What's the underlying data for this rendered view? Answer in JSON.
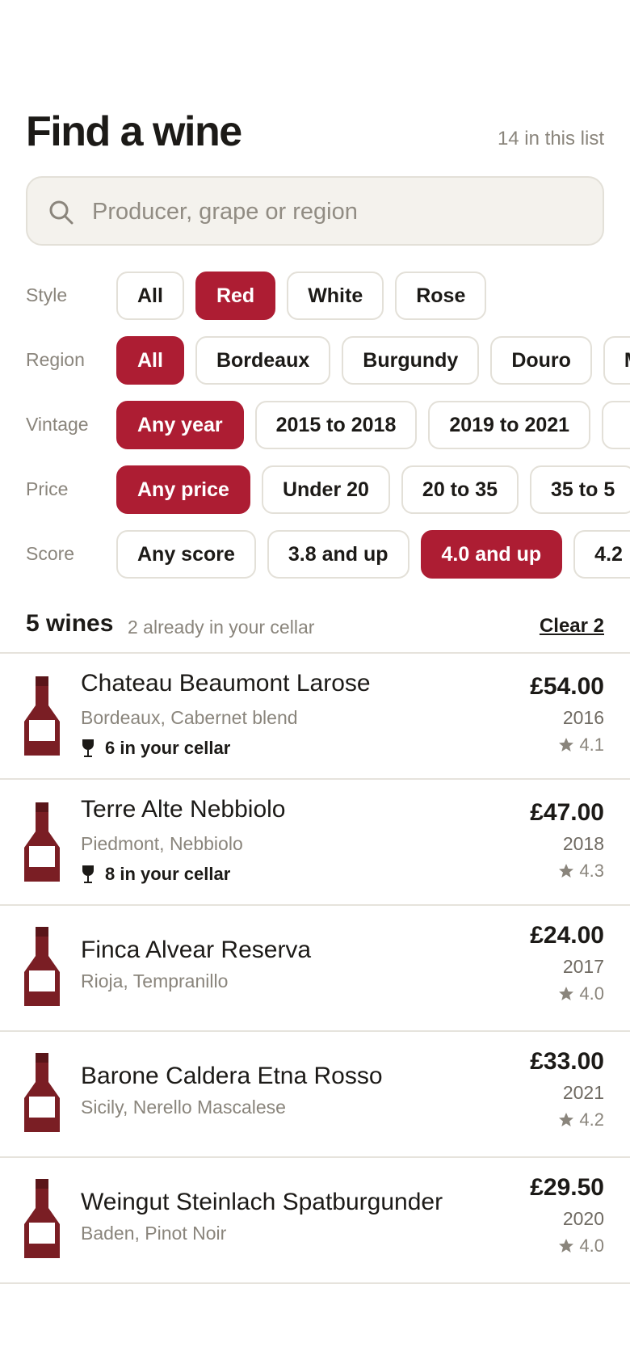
{
  "header": {
    "title": "Find a wine",
    "count_text": "14 in this list"
  },
  "search": {
    "placeholder": "Producer, grape or region",
    "value": ""
  },
  "filters": [
    {
      "label": "Style",
      "options": [
        {
          "label": "All",
          "active": false
        },
        {
          "label": "Red",
          "active": true
        },
        {
          "label": "White",
          "active": false
        },
        {
          "label": "Rose",
          "active": false
        }
      ]
    },
    {
      "label": "Region",
      "options": [
        {
          "label": "All",
          "active": true
        },
        {
          "label": "Bordeaux",
          "active": false
        },
        {
          "label": "Burgundy",
          "active": false
        },
        {
          "label": "Douro",
          "active": false
        },
        {
          "label": "M",
          "active": false
        }
      ]
    },
    {
      "label": "Vintage",
      "options": [
        {
          "label": "Any year",
          "active": true
        },
        {
          "label": "2015 to 2018",
          "active": false
        },
        {
          "label": "2019 to 2021",
          "active": false
        },
        {
          "label": "",
          "active": false
        }
      ]
    },
    {
      "label": "Price",
      "options": [
        {
          "label": "Any price",
          "active": true
        },
        {
          "label": "Under 20",
          "active": false
        },
        {
          "label": "20 to 35",
          "active": false
        },
        {
          "label": "35 to 5",
          "active": false
        }
      ]
    },
    {
      "label": "Score",
      "options": [
        {
          "label": "Any score",
          "active": false
        },
        {
          "label": "3.8 and up",
          "active": false
        },
        {
          "label": "4.0 and up",
          "active": true
        },
        {
          "label": "4.2",
          "active": false
        }
      ]
    }
  ],
  "summary": {
    "count": "5 wines",
    "note": "2 already in your cellar",
    "clear_label": "Clear 2"
  },
  "wines": [
    {
      "name": "Chateau Beaumont Larose",
      "sub": "Bordeaux, Cabernet blend",
      "cellar": "6 in your cellar",
      "price": "£54.00",
      "year": "2016",
      "score": "4.1"
    },
    {
      "name": "Terre Alte Nebbiolo",
      "sub": "Piedmont, Nebbiolo",
      "cellar": "8 in your cellar",
      "price": "£47.00",
      "year": "2018",
      "score": "4.3"
    },
    {
      "name": "Finca Alvear Reserva",
      "sub": "Rioja, Tempranillo",
      "cellar": "",
      "price": "£24.00",
      "year": "2017",
      "score": "4.0"
    },
    {
      "name": "Barone Caldera Etna Rosso",
      "sub": "Sicily, Nerello Mascalese",
      "cellar": "",
      "price": "£33.00",
      "year": "2021",
      "score": "4.2"
    },
    {
      "name": "Weingut Steinlach Spatburgunder",
      "sub": "Baden, Pinot Noir",
      "cellar": "",
      "price": "£29.50",
      "year": "2020",
      "score": "4.0"
    }
  ],
  "colors": {
    "accent": "#ad1d33",
    "bottle": "#7a1e24",
    "muted": "#8a857c"
  },
  "icons": {
    "search": "search-icon",
    "bottle": "wine-bottle-icon",
    "glass": "wine-glass-icon",
    "star": "star-icon"
  }
}
